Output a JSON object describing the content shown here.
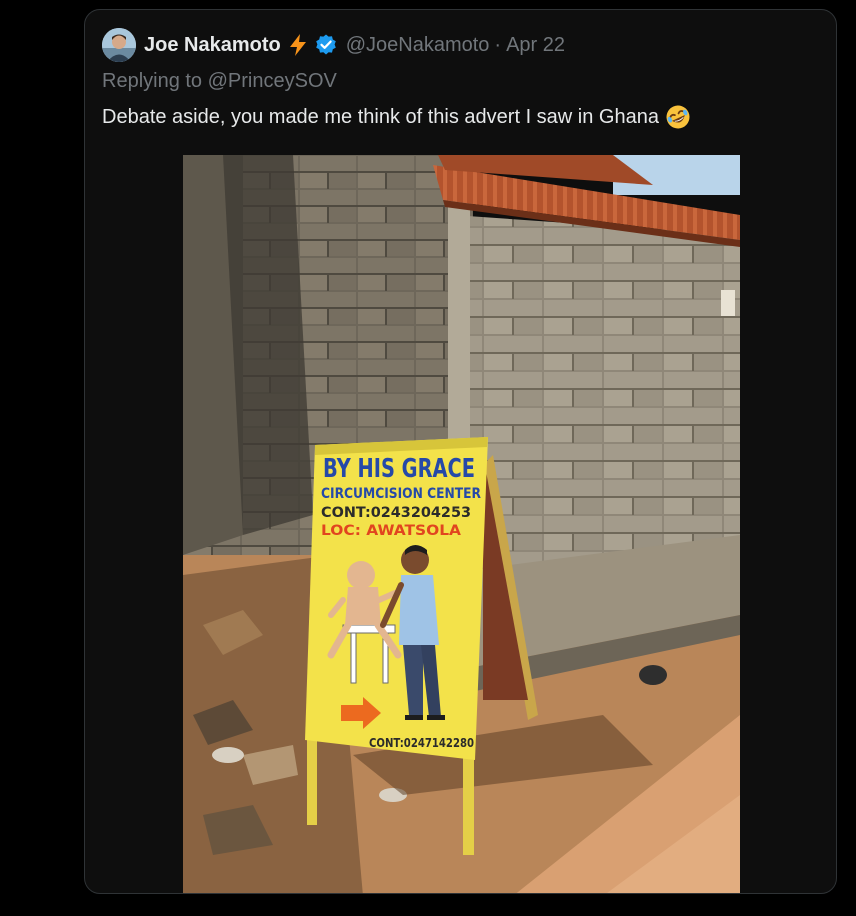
{
  "tweet": {
    "author": {
      "display_name": "Joe Nakamoto",
      "handle": "@JoeNakamoto",
      "avatar": "avatar",
      "badges": [
        "lightning-icon",
        "verified-icon"
      ],
      "verified_color": "#1d9bf0"
    },
    "separator": "·",
    "date": "Apr 22",
    "replying_prefix": "Replying to",
    "replying_to": "@PrinceySOV",
    "text": "Debate aside, you made me think of this advert I saw in Ghana",
    "emoji": "rolling-on-floor-laughing-emoji"
  },
  "photo": {
    "sign": {
      "line1": "BY HIS GRACE",
      "line2": "CIRCUMCISION CENTER",
      "line3": "CONT:0243204253",
      "line4": "LOC: AWATSOLA",
      "line5": "CONT:0247142280"
    }
  },
  "colors": {
    "background": "#000000",
    "card": "#0e0e0e",
    "card_border": "#2f3336",
    "primary_text": "#e7e9ea",
    "secondary_text": "#71767b",
    "sign_yellow": "#f3e24a"
  }
}
